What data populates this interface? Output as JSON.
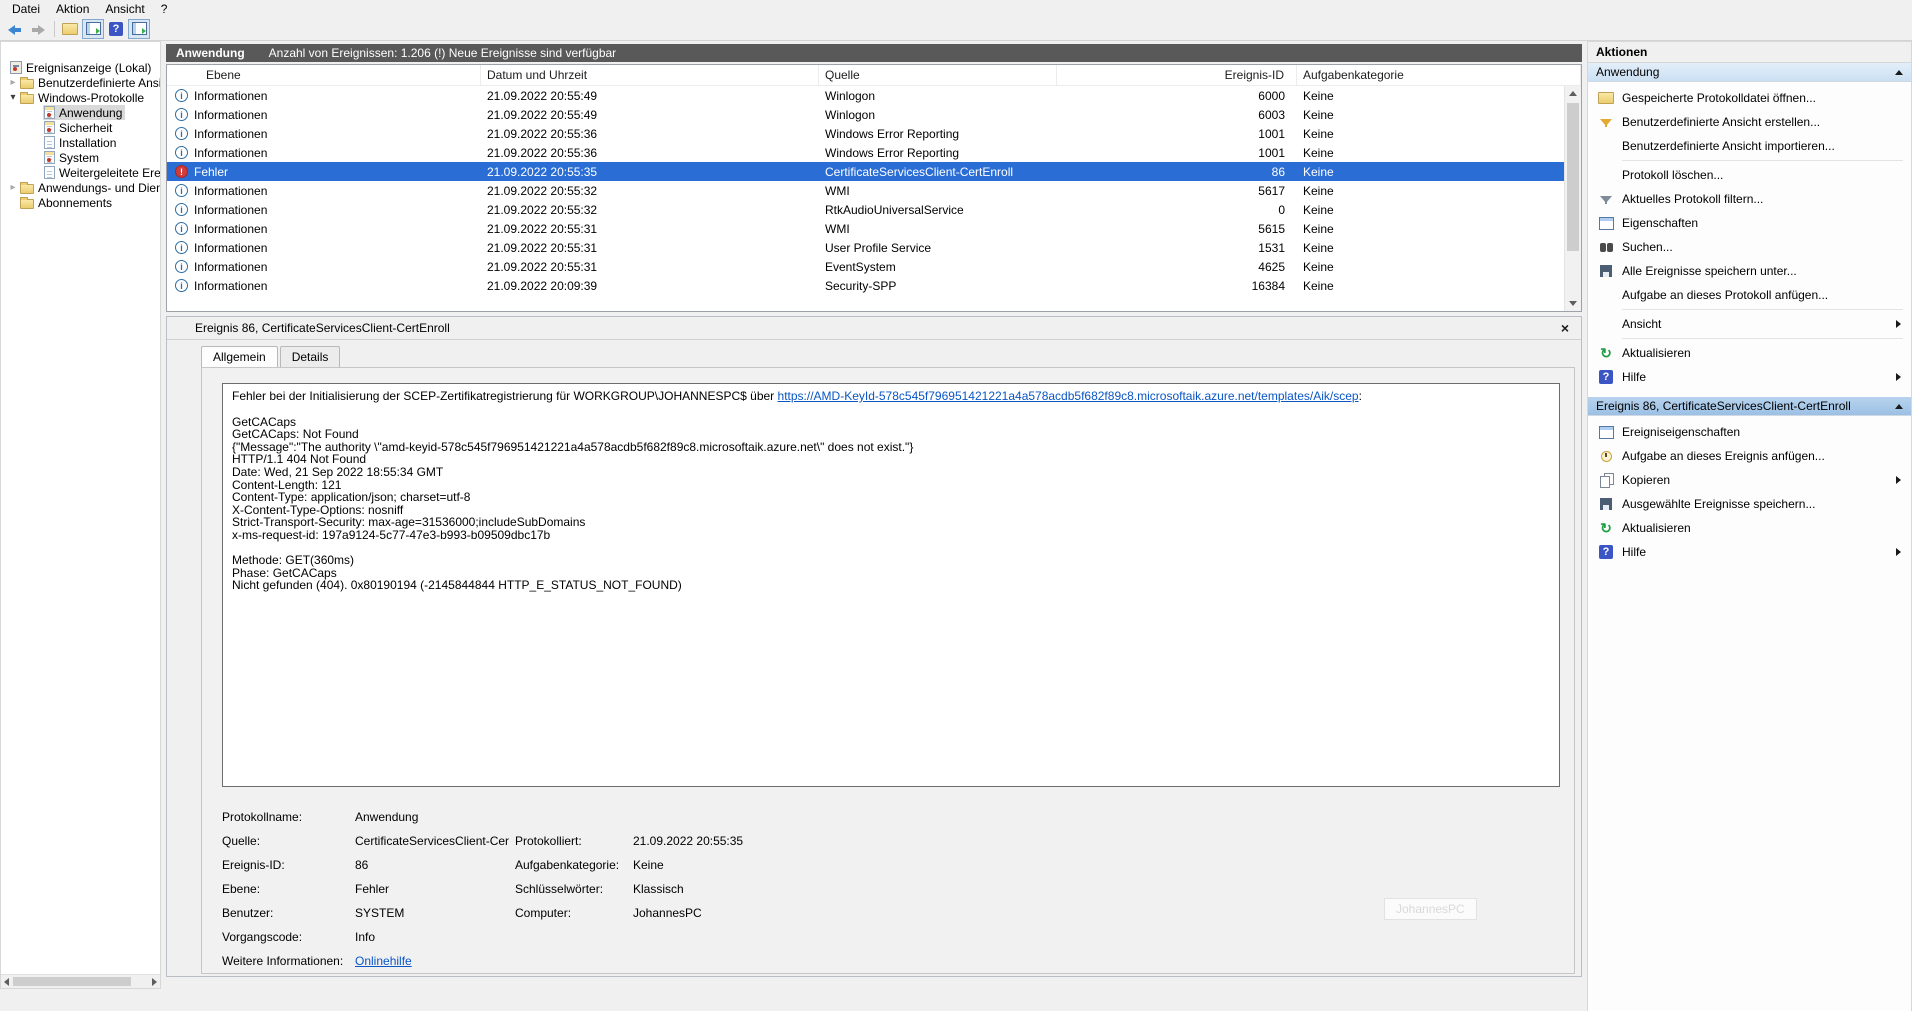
{
  "colors": {
    "selection_blue": "#2a6dd5",
    "titlebar_gray": "#595959",
    "link_blue": "#0a56c4"
  },
  "menu": {
    "items": [
      "Datei",
      "Aktion",
      "Ansicht",
      "?"
    ]
  },
  "toolbar": {
    "icons": [
      "back-icon",
      "forward-icon",
      "open-saved-log-icon",
      "console-tree-toggle-icon",
      "help-icon",
      "action-pane-toggle-icon"
    ]
  },
  "sidebar": {
    "items": [
      {
        "label": "Ereignisanzeige (Lokal)"
      },
      {
        "label": "Benutzerdefinierte Ansichten"
      },
      {
        "label": "Windows-Protokolle"
      },
      {
        "label": "Anwendung",
        "selected": true
      },
      {
        "label": "Sicherheit"
      },
      {
        "label": "Installation"
      },
      {
        "label": "System"
      },
      {
        "label": "Weitergeleitete Ereignisse"
      },
      {
        "label": "Anwendungs- und Dienstprotokolle"
      },
      {
        "label": "Abonnements"
      }
    ]
  },
  "list": {
    "title": "Anwendung",
    "subtitle": "Anzahl von Ereignissen: 1.206 (!) Neue Ereignisse sind verfügbar",
    "columns": [
      "Ebene",
      "Datum und Uhrzeit",
      "Quelle",
      "Ereignis-ID",
      "Aufgabenkategorie"
    ],
    "rows": [
      {
        "level": "Informationen",
        "type": "info",
        "datetime": "21.09.2022 20:55:49",
        "source": "Winlogon",
        "id": "6000",
        "category": "Keine"
      },
      {
        "level": "Informationen",
        "type": "info",
        "datetime": "21.09.2022 20:55:49",
        "source": "Winlogon",
        "id": "6003",
        "category": "Keine"
      },
      {
        "level": "Informationen",
        "type": "info",
        "datetime": "21.09.2022 20:55:36",
        "source": "Windows Error Reporting",
        "id": "1001",
        "category": "Keine"
      },
      {
        "level": "Informationen",
        "type": "info",
        "datetime": "21.09.2022 20:55:36",
        "source": "Windows Error Reporting",
        "id": "1001",
        "category": "Keine"
      },
      {
        "level": "Fehler",
        "type": "error",
        "selected": true,
        "datetime": "21.09.2022 20:55:35",
        "source": "CertificateServicesClient-CertEnroll",
        "id": "86",
        "category": "Keine"
      },
      {
        "level": "Informationen",
        "type": "info",
        "datetime": "21.09.2022 20:55:32",
        "source": "WMI",
        "id": "5617",
        "category": "Keine"
      },
      {
        "level": "Informationen",
        "type": "info",
        "datetime": "21.09.2022 20:55:32",
        "source": "RtkAudioUniversalService",
        "id": "0",
        "category": "Keine"
      },
      {
        "level": "Informationen",
        "type": "info",
        "datetime": "21.09.2022 20:55:31",
        "source": "WMI",
        "id": "5615",
        "category": "Keine"
      },
      {
        "level": "Informationen",
        "type": "info",
        "datetime": "21.09.2022 20:55:31",
        "source": "User Profile Service",
        "id": "1531",
        "category": "Keine"
      },
      {
        "level": "Informationen",
        "type": "info",
        "datetime": "21.09.2022 20:55:31",
        "source": "EventSystem",
        "id": "4625",
        "category": "Keine"
      },
      {
        "level": "Informationen",
        "type": "info",
        "datetime": "21.09.2022 20:09:39",
        "source": "Security-SPP",
        "id": "16384",
        "category": "Keine"
      }
    ]
  },
  "detail": {
    "header": "Ereignis 86, CertificateServicesClient-CertEnroll",
    "tabs": [
      "Allgemein",
      "Details"
    ],
    "message": {
      "intro": "Fehler bei der Initialisierung der SCEP-Zertifikatregistrierung für WORKGROUP\\JOHANNESPC$ über ",
      "link": "https://AMD-KeyId-578c545f796951421221a4a578acdb5f682f89c8.microsoftaik.azure.net/templates/Aik/scep",
      "after_link": ":",
      "body": "GetCACaps\nGetCACaps: Not Found\n{\"Message\":\"The authority \\\"amd-keyid-578c545f796951421221a4a578acdb5f682f89c8.microsoftaik.azure.net\\\" does not exist.\"}\nHTTP/1.1 404 Not Found\nDate: Wed, 21 Sep 2022 18:55:34 GMT\nContent-Length: 121\nContent-Type: application/json; charset=utf-8\nX-Content-Type-Options: nosniff\nStrict-Transport-Security: max-age=31536000;includeSubDomains\nx-ms-request-id: 197a9124-5c77-47e3-b993-b09509dbc17b\n\nMethode: GET(360ms)\nPhase: GetCACaps\nNicht gefunden (404). 0x80190194 (-2145844844 HTTP_E_STATUS_NOT_FOUND)"
    },
    "field_rows": [
      {
        "l1": "Protokollname:",
        "v1": "Anwendung",
        "l2": "",
        "v2": ""
      },
      {
        "l1": "Quelle:",
        "v1": "CertificateServicesClient-Cer",
        "l2": "Protokolliert:",
        "v2": "21.09.2022 20:55:35"
      },
      {
        "l1": "Ereignis-ID:",
        "v1": "86",
        "l2": "Aufgabenkategorie:",
        "v2": "Keine"
      },
      {
        "l1": "Ebene:",
        "v1": "Fehler",
        "l2": "Schlüsselwörter:",
        "v2": "Klassisch"
      },
      {
        "l1": "Benutzer:",
        "v1": "SYSTEM",
        "l2": "Computer:",
        "v2": "JohannesPC"
      },
      {
        "l1": "Vorgangscode:",
        "v1": "Info",
        "l2": "",
        "v2": ""
      },
      {
        "l1": "Weitere Informationen:",
        "v1": "Onlinehilfe",
        "v1_link": true,
        "l2": "",
        "v2": ""
      }
    ]
  },
  "watermark": "JohannesPC",
  "actions": {
    "panel_title": "Aktionen",
    "sections": [
      {
        "title": "Anwendung",
        "selected": false,
        "items": [
          {
            "label": "Gespeicherte Protokolldatei öffnen...",
            "icon": "open-folder-icon"
          },
          {
            "label": "Benutzerdefinierte Ansicht erstellen...",
            "icon": "create-view-icon"
          },
          {
            "label": "Benutzerdefinierte Ansicht importieren...",
            "icon": ""
          },
          {
            "label": "Protokoll löschen...",
            "icon": "",
            "sep_before": true
          },
          {
            "label": "Aktuelles Protokoll filtern...",
            "icon": "filter-icon"
          },
          {
            "label": "Eigenschaften",
            "icon": "properties-icon"
          },
          {
            "label": "Suchen...",
            "icon": "find-icon"
          },
          {
            "label": "Alle Ereignisse speichern unter...",
            "icon": "save-icon"
          },
          {
            "label": "Aufgabe an dieses Protokoll anfügen...",
            "icon": ""
          },
          {
            "label": "Ansicht",
            "icon": "",
            "submenu": true,
            "sep_before": true
          },
          {
            "label": "Aktualisieren",
            "icon": "refresh-icon",
            "sep_before": true
          },
          {
            "label": "Hilfe",
            "icon": "help-icon",
            "submenu": true
          }
        ]
      },
      {
        "title": "Ereignis 86, CertificateServicesClient-CertEnroll",
        "selected": true,
        "items": [
          {
            "label": "Ereigniseigenschaften",
            "icon": "properties-icon"
          },
          {
            "label": "Aufgabe an dieses Ereignis anfügen...",
            "icon": "attach-task-icon"
          },
          {
            "label": "Kopieren",
            "icon": "copy-icon",
            "submenu": true
          },
          {
            "label": "Ausgewählte Ereignisse speichern...",
            "icon": "save-icon"
          },
          {
            "label": "Aktualisieren",
            "icon": "refresh-icon"
          },
          {
            "label": "Hilfe",
            "icon": "help-icon",
            "submenu": true
          }
        ]
      }
    ]
  }
}
